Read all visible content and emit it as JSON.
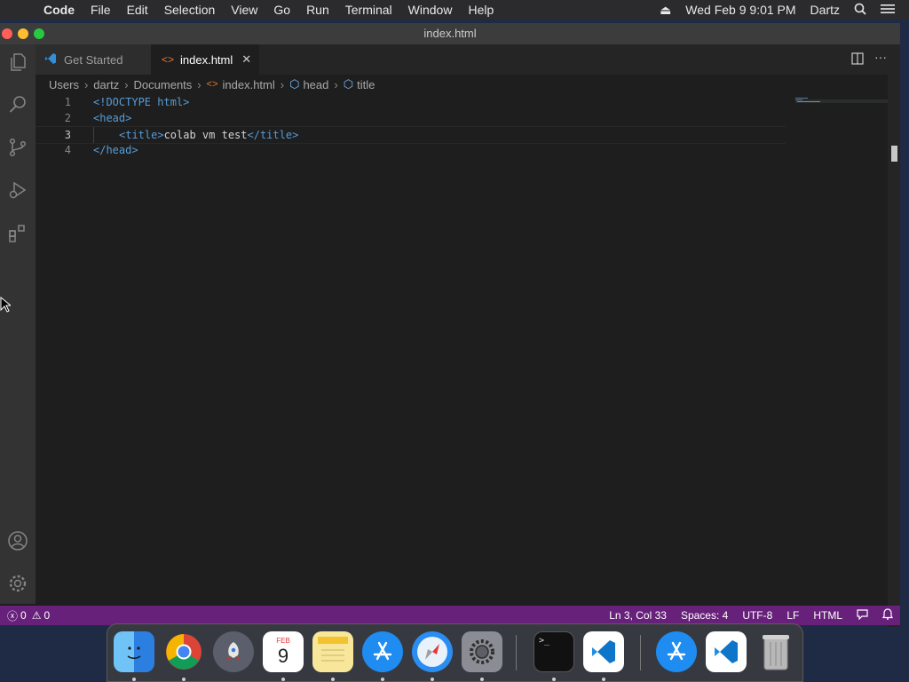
{
  "menubar": {
    "app": "Code",
    "items": [
      "File",
      "Edit",
      "Selection",
      "View",
      "Go",
      "Run",
      "Terminal",
      "Window",
      "Help"
    ],
    "datetime": "Wed Feb 9  9:01 PM",
    "user": "Dartz"
  },
  "window": {
    "title": "index.html"
  },
  "tabs": [
    {
      "label": "Get Started",
      "active": false
    },
    {
      "label": "index.html",
      "active": true
    }
  ],
  "breadcrumb": [
    "Users",
    "dartz",
    "Documents",
    "index.html",
    "head",
    "title"
  ],
  "editor": {
    "lines": [
      {
        "n": "1",
        "parts": [
          "<!DOCTYPE html>"
        ]
      },
      {
        "n": "2",
        "parts": [
          "<head>"
        ]
      },
      {
        "n": "3",
        "parts": [
          "<title>",
          "colab vm test",
          "</title>"
        ]
      },
      {
        "n": "4",
        "parts": [
          "</head>"
        ]
      }
    ]
  },
  "status": {
    "errors": "0",
    "warnings": "0",
    "position": "Ln 3, Col 33",
    "spaces": "Spaces: 4",
    "encoding": "UTF-8",
    "eol": "LF",
    "language": "HTML"
  },
  "dock": {
    "calendar_month": "FEB",
    "calendar_day": "9",
    "apps": [
      "finder-icon",
      "chrome-icon",
      "launchpad-icon",
      "calendar-icon",
      "notes-icon",
      "app-store-icon",
      "safari-icon",
      "system-preferences-icon",
      "terminal-icon",
      "vscode-icon",
      "app-store-installer-icon",
      "vscode-icon-2",
      "trash-icon"
    ]
  },
  "colors": {
    "statusbar": "#68217a",
    "accent": "#007acc",
    "tag": "#569cd6"
  }
}
